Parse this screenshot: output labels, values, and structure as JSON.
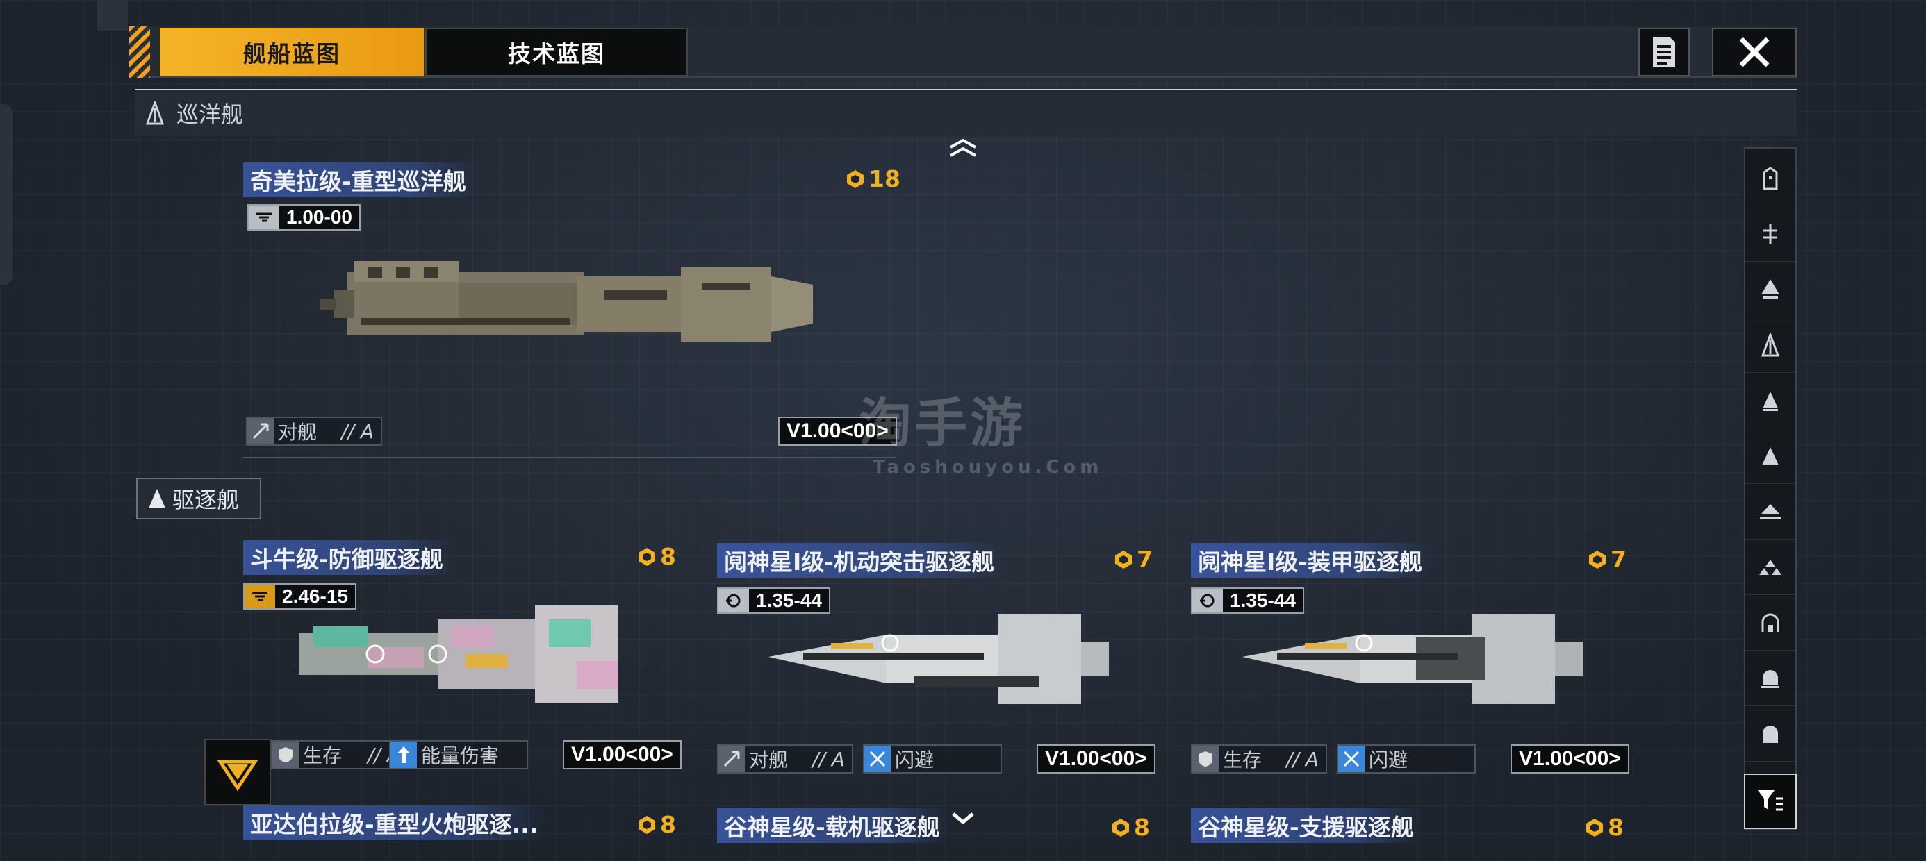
{
  "tabs": {
    "ship": "舰船蓝图",
    "tech": "技术蓝图"
  },
  "sections": {
    "cruiser": "巡洋舰",
    "destroyer": "驱逐舰"
  },
  "ships": [
    {
      "name": "奇美拉级-重型巡洋舰",
      "cost": "18",
      "stat": "1.00-00",
      "tags": [
        {
          "label": "对舰",
          "grade": "// A"
        }
      ],
      "version": "V1.00<00>"
    },
    {
      "name": "斗牛级-防御驱逐舰",
      "cost": "8",
      "stat": "2.46-15",
      "tags": [
        {
          "label": "生存",
          "grade": "// A"
        },
        {
          "label": "能量伤害",
          "grade": ""
        }
      ],
      "version": "V1.00<00>"
    },
    {
      "name": "阋神星I级-机动突击驱逐舰",
      "cost": "7",
      "stat": "1.35-44",
      "tags": [
        {
          "label": "对舰",
          "grade": "// A"
        },
        {
          "label": "闪避",
          "grade": ""
        }
      ],
      "version": "V1.00<00>"
    },
    {
      "name": "阋神星I级-装甲驱逐舰",
      "cost": "7",
      "stat": "1.35-44",
      "tags": [
        {
          "label": "生存",
          "grade": "// A"
        },
        {
          "label": "闪避",
          "grade": ""
        }
      ],
      "version": "V1.00<00>"
    },
    {
      "name": "亚达伯拉级-重型火炮驱逐...",
      "cost": "8"
    },
    {
      "name": "谷神星级-载机驱逐舰",
      "cost": "8"
    },
    {
      "name": "谷神星级-支援驱逐舰",
      "cost": "8"
    }
  ],
  "watermark": {
    "big": "淘手游",
    "small": "Taoshouyou.Com"
  },
  "icons": {
    "close": "close-icon",
    "doc": "document-icon",
    "filter": "filter-icon",
    "cost": "cost-icon",
    "up": "chevron-up-icon",
    "down": "chevron-down-icon"
  },
  "colors": {
    "accent": "#f2b01e",
    "name_bg": "#3c5aaa",
    "tag_blue": "#3b86d9"
  }
}
